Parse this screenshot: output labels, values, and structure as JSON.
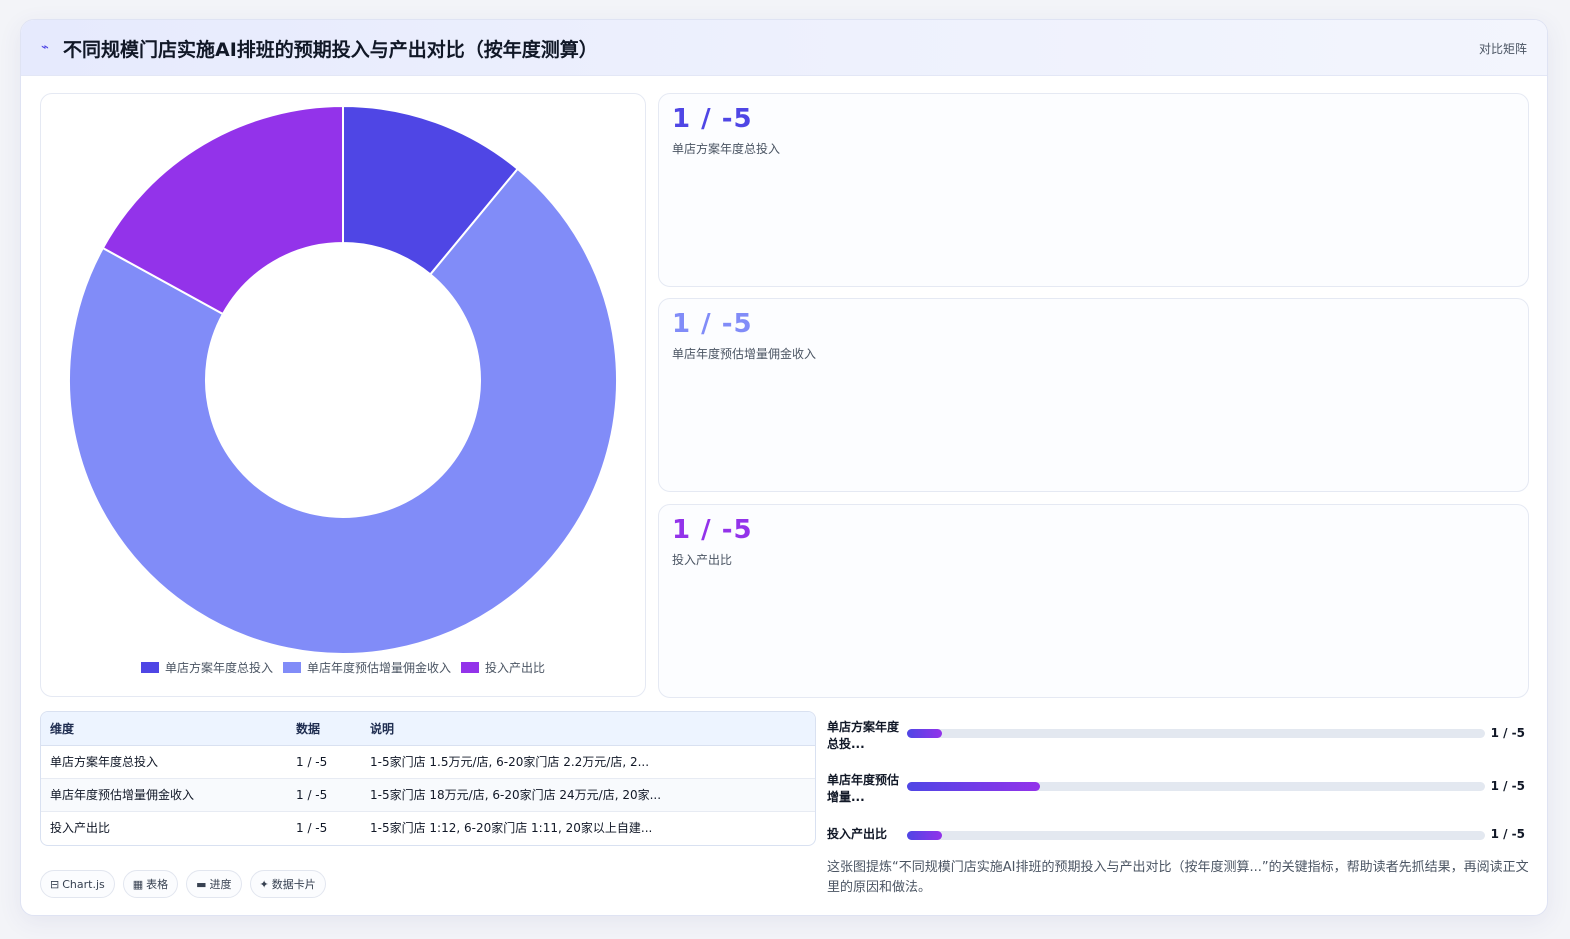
{
  "header": {
    "logo_icon": "wave-icon",
    "title": "不同规模门店实施AI排班的预期投入与产出对比（按年度测算）",
    "tag": "对比矩阵"
  },
  "chart_data": {
    "type": "doughnut",
    "categories": [
      "单店方案年度总投入",
      "单店年度预估增量佣金收入",
      "投入产出比"
    ],
    "values": [
      11,
      72,
      17
    ],
    "colors": [
      "#4f46e5",
      "#818cf8",
      "#9333ea"
    ],
    "legend": "bottom",
    "title": ""
  },
  "kpis": [
    {
      "value": "1 / -5",
      "label": "单店方案年度总投入",
      "color": "#4f46e5"
    },
    {
      "value": "1 / -5",
      "label": "单店年度预估增量佣金收入",
      "color": "#818cf8"
    },
    {
      "value": "1 / -5",
      "label": "投入产出比",
      "color": "#9333ea"
    }
  ],
  "table": {
    "headers": [
      "维度",
      "数据",
      "说明"
    ],
    "rows": [
      [
        "单店方案年度总投入",
        "1 / -5",
        "1-5家门店 1.5万元/店, 6-20家门店 2.2万元/店, 2..."
      ],
      [
        "单店年度预估增量佣金收入",
        "1 / -5",
        "1-5家门店 18万元/店, 6-20家门店 24万元/店, 20家..."
      ],
      [
        "投入产出比",
        "1 / -5",
        "1-5家门店 1:12, 6-20家门店 1:11, 20家以上自建..."
      ]
    ]
  },
  "progress": [
    {
      "label": "单店方案年度总投...",
      "value": "1 / -5",
      "fraction": 0.06
    },
    {
      "label": "单店年度预估增量...",
      "value": "1 / -5",
      "fraction": 0.23
    },
    {
      "label": "投入产出比",
      "value": "1 / -5",
      "fraction": 0.06
    }
  ],
  "chips": [
    {
      "icon": "chart-icon",
      "glyph": "⊟",
      "label": "Chart.js"
    },
    {
      "icon": "table-icon",
      "glyph": "▦",
      "label": "表格"
    },
    {
      "icon": "progress-icon",
      "glyph": "▬",
      "label": "进度"
    },
    {
      "icon": "sparkle-icon",
      "glyph": "✦",
      "label": "数据卡片"
    }
  ],
  "summary": "这张图提炼“不同规模门店实施AI排班的预期投入与产出对比（按年度测算...”的关键指标，帮助读者先抓结果，再阅读正文里的原因和做法。"
}
